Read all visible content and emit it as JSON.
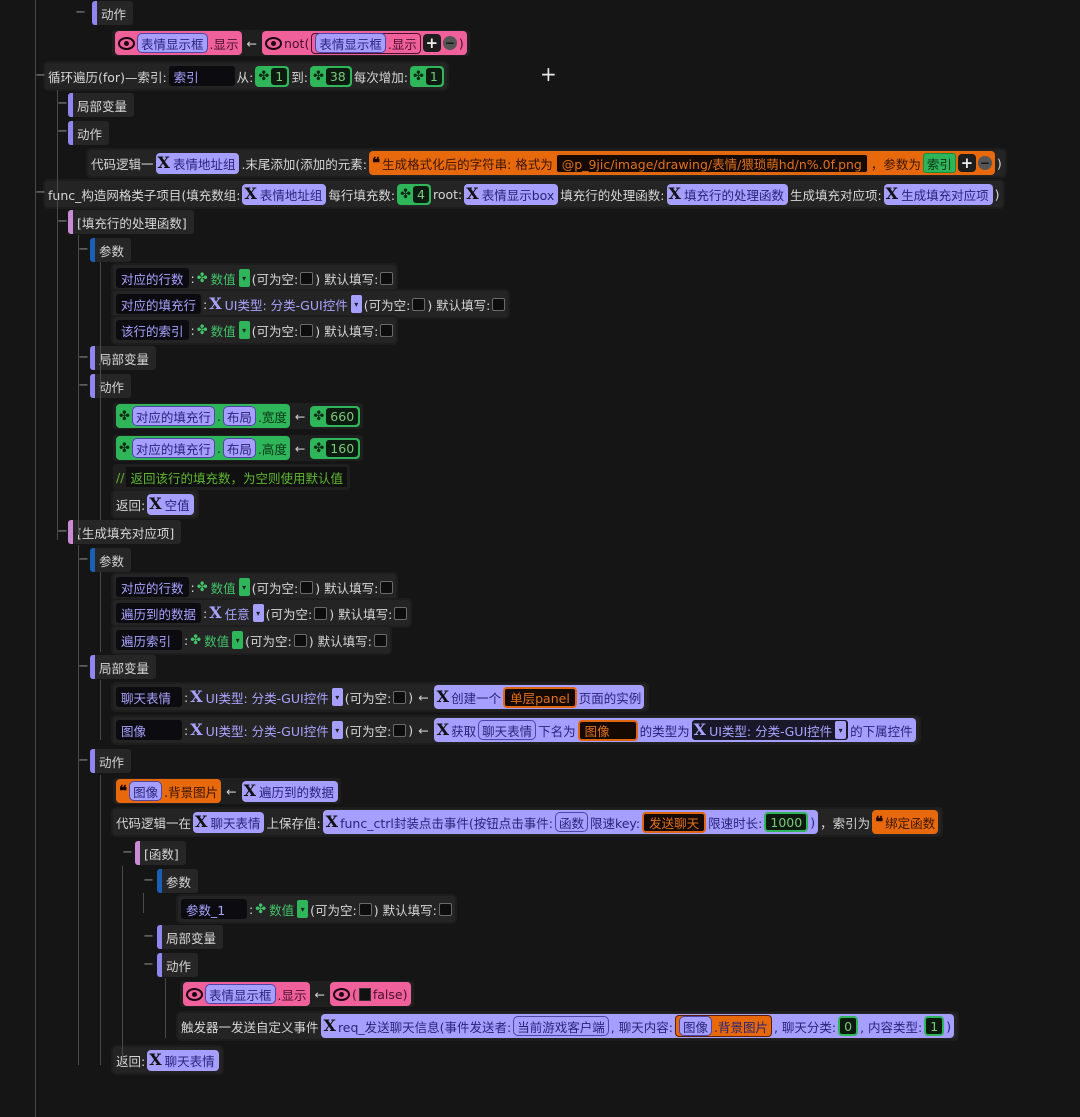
{
  "colors": {
    "accent_purple": "#a79fff",
    "green": "#2fb55a",
    "orange": "#e8690c",
    "pink": "#f0609a",
    "bg": "#151515"
  },
  "icons": {
    "variable": "x-icon",
    "number": "frog-icon",
    "string": "quote-icon",
    "bool": "eye-icon",
    "add": "plus-icon",
    "remove": "minus-icon",
    "dropdown": "chevron-down-icon"
  },
  "toggles": {
    "collapse": "−",
    "add": "+"
  },
  "rows": [
    {
      "k": "hdr",
      "bar": "#8f86f0",
      "v": "动作"
    },
    {
      "k": "row",
      "c": [
        {
          "k": "grp",
          "g": "pink",
          "c": [
            {
              "k": "eye"
            },
            {
              "k": "ref",
              "v": "表情显示框"
            },
            {
              "k": "t",
              "v": ".显示"
            }
          ]
        },
        {
          "k": "arrow",
          "v": "←"
        },
        {
          "k": "grp",
          "g": "pink",
          "c": [
            {
              "k": "eye"
            },
            {
              "k": "t",
              "v": "not("
            },
            {
              "k": "grp",
              "g": "inner",
              "c": [
                {
                  "k": "ref",
                  "v": "表情显示框"
                },
                {
                  "k": "t",
                  "v": ".显示"
                }
              ]
            },
            {
              "k": "plus",
              "v": "+"
            },
            {
              "k": "minus",
              "v": "−"
            },
            {
              "k": "t",
              "v": ")"
            }
          ]
        }
      ]
    },
    {
      "k": "row",
      "dark": true,
      "c": [
        {
          "k": "t",
          "v": "循环遍历(for)—索引:"
        },
        {
          "k": "name",
          "v": "索引"
        },
        {
          "k": "t",
          "v": "从:"
        },
        {
          "k": "num",
          "v": "1"
        },
        {
          "k": "t",
          "v": "到:"
        },
        {
          "k": "num",
          "v": "38"
        },
        {
          "k": "t",
          "v": "每次增加:"
        },
        {
          "k": "num",
          "v": "1"
        }
      ]
    },
    {
      "k": "hdr",
      "bar": "#8f86f0",
      "v": "局部变量"
    },
    {
      "k": "hdr",
      "bar": "#8f86f0",
      "v": "动作"
    },
    {
      "k": "row",
      "dark": true,
      "c": [
        {
          "k": "t",
          "v": "代码逻辑一"
        },
        {
          "k": "xv",
          "v": "表情地址组"
        },
        {
          "k": "t",
          "v": ".末尾添加(添加的元素:"
        },
        {
          "k": "grp",
          "g": "orange",
          "c": [
            {
              "k": "q"
            },
            {
              "k": "t",
              "v": "生成格式化后的字符串: 格式为"
            },
            {
              "k": "strv",
              "v": "@p_9jic/image/drawing/表情/猥琐萌hd/n%.0f.png"
            },
            {
              "k": "t",
              "v": "，参数为"
            },
            {
              "k": "gref",
              "v": "索引"
            },
            {
              "k": "plus",
              "v": "+"
            },
            {
              "k": "minus",
              "v": "−"
            }
          ]
        },
        {
          "k": "t",
          "v": ")"
        }
      ]
    },
    {
      "k": "row",
      "dark": true,
      "c": [
        {
          "k": "t",
          "v": "func_构造网格类子项目(填充数组:"
        },
        {
          "k": "xv",
          "v": "表情地址组"
        },
        {
          "k": "t",
          "v": "每行填充数:"
        },
        {
          "k": "num",
          "v": "4"
        },
        {
          "k": "t",
          "v": "root:"
        },
        {
          "k": "xv",
          "v": "表情显示box"
        },
        {
          "k": "t",
          "v": "填充行的处理函数:"
        },
        {
          "k": "xv",
          "v": "填充行的处理函数"
        },
        {
          "k": "t",
          "v": "生成填充对应项:"
        },
        {
          "k": "xv",
          "v": "生成填充对应项"
        },
        {
          "k": "t",
          "v": ")"
        }
      ]
    },
    {
      "k": "hdr",
      "bar": "#c98ad6",
      "v": "[填充行的处理函数]"
    },
    {
      "k": "hdr",
      "bar": "#1a5fb4",
      "v": "参数"
    },
    {
      "k": "row",
      "dark": true,
      "c": [
        {
          "k": "name",
          "v": "对应的行数"
        },
        {
          "k": "t",
          "v": ":"
        },
        {
          "k": "numtype",
          "v": "数值"
        },
        {
          "k": "t",
          "v": "(可为空:"
        },
        {
          "k": "cb"
        },
        {
          "k": "t",
          "v": ")  默认填写:"
        },
        {
          "k": "cb"
        }
      ]
    },
    {
      "k": "row",
      "dark": true,
      "c": [
        {
          "k": "name",
          "v": "对应的填充行"
        },
        {
          "k": "t",
          "v": ":"
        },
        {
          "k": "xtype",
          "v": "UI类型: 分类-GUI控件"
        },
        {
          "k": "t",
          "v": "(可为空:"
        },
        {
          "k": "cb"
        },
        {
          "k": "t",
          "v": ")  默认填写:"
        },
        {
          "k": "cb"
        }
      ]
    },
    {
      "k": "row",
      "dark": true,
      "c": [
        {
          "k": "name",
          "v": "该行的索引"
        },
        {
          "k": "t",
          "v": ":"
        },
        {
          "k": "numtype",
          "v": "数值"
        },
        {
          "k": "t",
          "v": "(可为空:"
        },
        {
          "k": "cb"
        },
        {
          "k": "t",
          "v": ")  默认填写:"
        },
        {
          "k": "cb"
        }
      ]
    },
    {
      "k": "hdr",
      "bar": "#8f86f0",
      "v": "局部变量"
    },
    {
      "k": "hdr",
      "bar": "#8f86f0",
      "v": "动作"
    },
    {
      "k": "row",
      "c": [
        {
          "k": "grp",
          "g": "green",
          "c": [
            {
              "k": "frog"
            },
            {
              "k": "ref",
              "v": "对应的填充行"
            },
            {
              "k": "t",
              "v": "."
            },
            {
              "k": "ref",
              "v": "布局"
            },
            {
              "k": "t",
              "v": ".宽度"
            }
          ]
        },
        {
          "k": "arrow",
          "v": "←"
        },
        {
          "k": "num",
          "v": "660"
        }
      ]
    },
    {
      "k": "row",
      "c": [
        {
          "k": "grp",
          "g": "green",
          "c": [
            {
              "k": "frog"
            },
            {
              "k": "ref",
              "v": "对应的填充行"
            },
            {
              "k": "t",
              "v": "."
            },
            {
              "k": "ref",
              "v": "布局"
            },
            {
              "k": "t",
              "v": ".高度"
            }
          ]
        },
        {
          "k": "arrow",
          "v": "←"
        },
        {
          "k": "num",
          "v": "160"
        }
      ]
    },
    {
      "k": "row",
      "c": [
        {
          "k": "cmtsl",
          "v": "//"
        },
        {
          "k": "cmt",
          "v": "返回该行的填充数，为空则使用默认值"
        }
      ]
    },
    {
      "k": "row",
      "dark": true,
      "c": [
        {
          "k": "t",
          "v": "返回:"
        },
        {
          "k": "xv",
          "v": "空值"
        }
      ]
    },
    {
      "k": "hdr",
      "bar": "#c98ad6",
      "v": "[生成填充对应项]"
    },
    {
      "k": "hdr",
      "bar": "#1a5fb4",
      "v": "参数"
    },
    {
      "k": "row",
      "dark": true,
      "c": [
        {
          "k": "name",
          "v": "对应的行数"
        },
        {
          "k": "t",
          "v": ":"
        },
        {
          "k": "numtype",
          "v": "数值"
        },
        {
          "k": "t",
          "v": "(可为空:"
        },
        {
          "k": "cb"
        },
        {
          "k": "t",
          "v": ")  默认填写:"
        },
        {
          "k": "cb"
        }
      ]
    },
    {
      "k": "row",
      "dark": true,
      "c": [
        {
          "k": "name",
          "v": "遍历到的数据"
        },
        {
          "k": "t",
          "v": ":"
        },
        {
          "k": "xtype",
          "v": "任意"
        },
        {
          "k": "t",
          "v": "(可为空:"
        },
        {
          "k": "cb"
        },
        {
          "k": "t",
          "v": ")  默认填写:"
        },
        {
          "k": "cb"
        }
      ]
    },
    {
      "k": "row",
      "dark": true,
      "c": [
        {
          "k": "name",
          "v": "遍历索引"
        },
        {
          "k": "t",
          "v": ":"
        },
        {
          "k": "numtype",
          "v": "数值"
        },
        {
          "k": "t",
          "v": "(可为空:"
        },
        {
          "k": "cb"
        },
        {
          "k": "t",
          "v": ")  默认填写:"
        },
        {
          "k": "cb"
        }
      ]
    },
    {
      "k": "hdr",
      "bar": "#8f86f0",
      "v": "局部变量"
    },
    {
      "k": "row",
      "dark": true,
      "c": [
        {
          "k": "name",
          "v": "聊天表情"
        },
        {
          "k": "t",
          "v": ":"
        },
        {
          "k": "xtype",
          "v": "UI类型: 分类-GUI控件"
        },
        {
          "k": "t",
          "v": "(可为空:"
        },
        {
          "k": "cb"
        },
        {
          "k": "t",
          "v": ")"
        },
        {
          "k": "arrow",
          "v": "←"
        },
        {
          "k": "grp",
          "g": "x",
          "c": [
            {
              "k": "xi"
            },
            {
              "k": "t",
              "v": "创建一个"
            },
            {
              "k": "strv",
              "v": "单层panel"
            },
            {
              "k": "t",
              "v": "页面的实例"
            }
          ]
        }
      ]
    },
    {
      "k": "row",
      "dark": true,
      "c": [
        {
          "k": "name",
          "v": "图像"
        },
        {
          "k": "t",
          "v": ":"
        },
        {
          "k": "xtype",
          "v": "UI类型: 分类-GUI控件"
        },
        {
          "k": "t",
          "v": "(可为空:"
        },
        {
          "k": "cb"
        },
        {
          "k": "t",
          "v": ")"
        },
        {
          "k": "arrow",
          "v": "←"
        },
        {
          "k": "grp",
          "g": "x",
          "c": [
            {
              "k": "xi"
            },
            {
              "k": "t",
              "v": "获取"
            },
            {
              "k": "ref",
              "v": "聊天表情"
            },
            {
              "k": "t",
              "v": "下名为"
            },
            {
              "k": "strv",
              "v": "图像"
            },
            {
              "k": "t",
              "v": "的类型为"
            },
            {
              "k": "xtypedark",
              "v": "UI类型: 分类-GUI控件"
            },
            {
              "k": "t",
              "v": "的下属控件"
            }
          ]
        }
      ]
    },
    {
      "k": "hdr",
      "bar": "#8f86f0",
      "v": "动作"
    },
    {
      "k": "row",
      "c": [
        {
          "k": "grp",
          "g": "orange",
          "c": [
            {
              "k": "q"
            },
            {
              "k": "ref",
              "v": "图像"
            },
            {
              "k": "t",
              "v": ".背景图片"
            }
          ]
        },
        {
          "k": "arrow",
          "v": "←"
        },
        {
          "k": "xv",
          "v": "遍历到的数据"
        }
      ]
    },
    {
      "k": "row",
      "dark": true,
      "c": [
        {
          "k": "t",
          "v": "代码逻辑一在"
        },
        {
          "k": "xv",
          "v": "聊天表情"
        },
        {
          "k": "t",
          "v": "上保存值:"
        },
        {
          "k": "grp",
          "g": "x",
          "c": [
            {
              "k": "xi"
            },
            {
              "k": "t",
              "v": "func_ctrl封装点击事件(按钮点击事件:"
            },
            {
              "k": "ref",
              "v": "函数"
            },
            {
              "k": "t",
              "v": "限速key:"
            },
            {
              "k": "strv",
              "v": "发送聊天"
            },
            {
              "k": "t",
              "v": "限速时长:"
            },
            {
              "k": "numbox",
              "v": "1000"
            },
            {
              "k": "t",
              "v": ")"
            }
          ]
        },
        {
          "k": "t",
          "v": "，索引为"
        },
        {
          "k": "grp",
          "g": "orange",
          "c": [
            {
              "k": "q"
            },
            {
              "k": "t",
              "v": "绑定函数"
            }
          ]
        }
      ]
    },
    {
      "k": "hdr",
      "bar": "#c98ad6",
      "v": "[函数]"
    },
    {
      "k": "hdr",
      "bar": "#1a5fb4",
      "v": "参数"
    },
    {
      "k": "row",
      "dark": true,
      "c": [
        {
          "k": "name",
          "v": "参数_1"
        },
        {
          "k": "t",
          "v": ":"
        },
        {
          "k": "numtype",
          "v": "数值"
        },
        {
          "k": "t",
          "v": "(可为空:"
        },
        {
          "k": "cb"
        },
        {
          "k": "t",
          "v": ")  默认填写:"
        },
        {
          "k": "cb"
        }
      ]
    },
    {
      "k": "hdr",
      "bar": "#8f86f0",
      "v": "局部变量"
    },
    {
      "k": "hdr",
      "bar": "#8f86f0",
      "v": "动作"
    },
    {
      "k": "row",
      "c": [
        {
          "k": "grp",
          "g": "pink",
          "c": [
            {
              "k": "eye"
            },
            {
              "k": "ref",
              "v": "表情显示框"
            },
            {
              "k": "t",
              "v": ".显示"
            }
          ]
        },
        {
          "k": "arrow",
          "v": "←"
        },
        {
          "k": "grp",
          "g": "pink",
          "c": [
            {
              "k": "eye"
            },
            {
              "k": "t",
              "v": "("
            },
            {
              "k": "blk"
            },
            {
              "k": "t",
              "v": "false)"
            }
          ]
        }
      ]
    },
    {
      "k": "row",
      "dark": true,
      "c": [
        {
          "k": "t",
          "v": "触发器一发送自定义事件"
        },
        {
          "k": "grp",
          "g": "x",
          "c": [
            {
              "k": "xi"
            },
            {
              "k": "t",
              "v": "req_发送聊天信息(事件发送者:"
            },
            {
              "k": "ref",
              "v": "当前游戏客户端"
            },
            {
              "k": "t",
              "v": ", 聊天内容:"
            },
            {
              "k": "grp",
              "g": "innero",
              "c": [
                {
                  "k": "ref",
                  "v": "图像"
                },
                {
                  "k": "t",
                  "v": ".背景图片"
                }
              ]
            },
            {
              "k": "t",
              "v": ", 聊天分类:"
            },
            {
              "k": "numbox",
              "v": "0"
            },
            {
              "k": "t",
              "v": ", 内容类型:"
            },
            {
              "k": "numbox",
              "v": "1"
            },
            {
              "k": "t",
              "v": ")"
            }
          ]
        }
      ]
    },
    {
      "k": "row",
      "dark": true,
      "c": [
        {
          "k": "t",
          "v": "返回:"
        },
        {
          "k": "xv",
          "v": "聊天表情"
        }
      ]
    }
  ]
}
